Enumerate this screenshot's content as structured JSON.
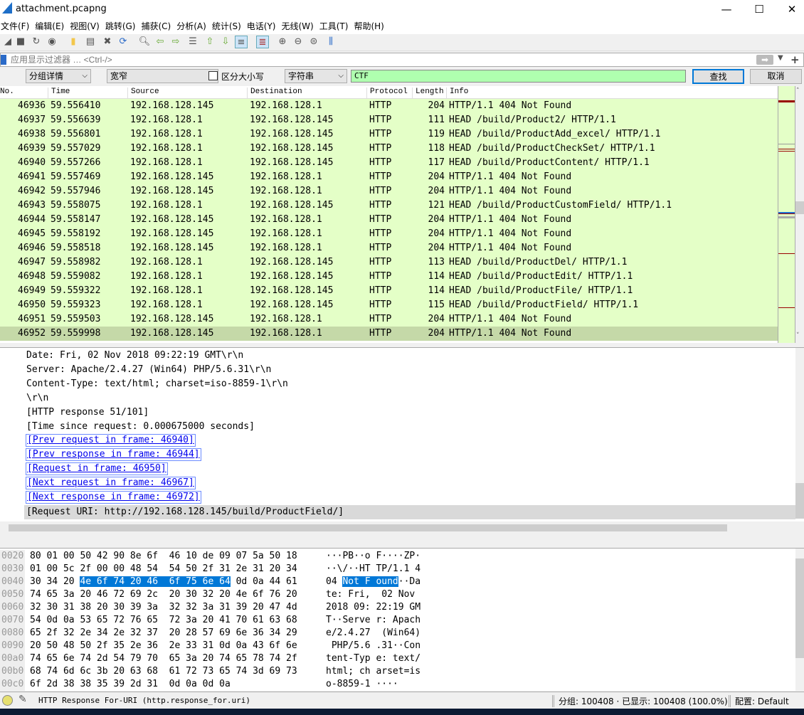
{
  "window": {
    "title": "attachment.pcapng"
  },
  "menu": [
    "文件(F)",
    "编辑(E)",
    "视图(V)",
    "跳转(G)",
    "捕获(C)",
    "分析(A)",
    "统计(S)",
    "电话(Y)",
    "无线(W)",
    "工具(T)",
    "帮助(H)"
  ],
  "filter": {
    "placeholder": "应用显示过滤器 … <Ctrl-/>"
  },
  "find": {
    "search_in": "分组详情",
    "charset": "宽窄",
    "case_label": "区分大小写",
    "case_checked": false,
    "type": "字符串",
    "value": "CTF",
    "find_label": "查找",
    "cancel_label": "取消"
  },
  "packet_list": {
    "columns": [
      "No.",
      "Time",
      "Source",
      "Destination",
      "Protocol",
      "Length",
      "Info"
    ],
    "rows": [
      [
        "46936",
        "59.556410",
        "192.168.128.145",
        "192.168.128.1",
        "HTTP",
        "204",
        "HTTP/1.1 404 Not Found"
      ],
      [
        "46937",
        "59.556639",
        "192.168.128.1",
        "192.168.128.145",
        "HTTP",
        "111",
        "HEAD /build/Product2/ HTTP/1.1"
      ],
      [
        "46938",
        "59.556801",
        "192.168.128.1",
        "192.168.128.145",
        "HTTP",
        "119",
        "HEAD /build/ProductAdd_excel/ HTTP/1.1"
      ],
      [
        "46939",
        "59.557029",
        "192.168.128.1",
        "192.168.128.145",
        "HTTP",
        "118",
        "HEAD /build/ProductCheckSet/ HTTP/1.1"
      ],
      [
        "46940",
        "59.557266",
        "192.168.128.1",
        "192.168.128.145",
        "HTTP",
        "117",
        "HEAD /build/ProductContent/ HTTP/1.1"
      ],
      [
        "46941",
        "59.557469",
        "192.168.128.145",
        "192.168.128.1",
        "HTTP",
        "204",
        "HTTP/1.1 404 Not Found"
      ],
      [
        "46942",
        "59.557946",
        "192.168.128.145",
        "192.168.128.1",
        "HTTP",
        "204",
        "HTTP/1.1 404 Not Found"
      ],
      [
        "46943",
        "59.558075",
        "192.168.128.1",
        "192.168.128.145",
        "HTTP",
        "121",
        "HEAD /build/ProductCustomField/ HTTP/1.1"
      ],
      [
        "46944",
        "59.558147",
        "192.168.128.145",
        "192.168.128.1",
        "HTTP",
        "204",
        "HTTP/1.1 404 Not Found"
      ],
      [
        "46945",
        "59.558192",
        "192.168.128.145",
        "192.168.128.1",
        "HTTP",
        "204",
        "HTTP/1.1 404 Not Found"
      ],
      [
        "46946",
        "59.558518",
        "192.168.128.145",
        "192.168.128.1",
        "HTTP",
        "204",
        "HTTP/1.1 404 Not Found"
      ],
      [
        "46947",
        "59.558982",
        "192.168.128.1",
        "192.168.128.145",
        "HTTP",
        "113",
        "HEAD /build/ProductDel/ HTTP/1.1"
      ],
      [
        "46948",
        "59.559082",
        "192.168.128.1",
        "192.168.128.145",
        "HTTP",
        "114",
        "HEAD /build/ProductEdit/ HTTP/1.1"
      ],
      [
        "46949",
        "59.559322",
        "192.168.128.1",
        "192.168.128.145",
        "HTTP",
        "114",
        "HEAD /build/ProductFile/ HTTP/1.1"
      ],
      [
        "46950",
        "59.559323",
        "192.168.128.1",
        "192.168.128.145",
        "HTTP",
        "115",
        "HEAD /build/ProductField/ HTTP/1.1"
      ],
      [
        "46951",
        "59.559503",
        "192.168.128.145",
        "192.168.128.1",
        "HTTP",
        "204",
        "HTTP/1.1 404 Not Found"
      ],
      [
        "46952",
        "59.559998",
        "192.168.128.145",
        "192.168.128.1",
        "HTTP",
        "204",
        "HTTP/1.1 404 Not Found"
      ]
    ],
    "selected": "46952",
    "row_color": "#e4ffc7"
  },
  "details": [
    {
      "text": "Date: Fri, 02 Nov 2018 09:22:19 GMT\\r\\n",
      "type": "plain"
    },
    {
      "text": "Server: Apache/2.4.27 (Win64) PHP/5.6.31\\r\\n",
      "type": "plain"
    },
    {
      "text": "Content-Type: text/html; charset=iso-8859-1\\r\\n",
      "type": "plain"
    },
    {
      "text": "\\r\\n",
      "type": "plain"
    },
    {
      "text": "[HTTP response 51/101]",
      "type": "plain"
    },
    {
      "text": "[Time since request: 0.000675000 seconds]",
      "type": "plain"
    },
    {
      "text": "[Prev request in frame: 46940]",
      "type": "link"
    },
    {
      "text": "[Prev response in frame: 46944]",
      "type": "link"
    },
    {
      "text": "[Request in frame: 46950]",
      "type": "link"
    },
    {
      "text": "[Next request in frame: 46967]",
      "type": "link"
    },
    {
      "text": "[Next response in frame: 46972]",
      "type": "link"
    },
    {
      "text": "[Request URI: http://192.168.128.145/build/ProductField/]",
      "type": "selected"
    }
  ],
  "hex": [
    {
      "off": "0020",
      "a": "80 01 00 50 42 90 8e 6f",
      "b": "46 10 de 09 07 5a 50 18",
      "asc": "···PB··o F····ZP·"
    },
    {
      "off": "0030",
      "a": "01 00 5c 2f 00 00 48 54",
      "b": "54 50 2f 31 2e 31 20 34",
      "asc": "··\\/··HT TP/1.1 4"
    },
    {
      "off": "0040",
      "a": "30 34 20 ",
      "hl1": "4e 6f 74 20 46",
      "b": "",
      "hl2": "6f 75 6e 64",
      "rest": " 0d 0a 44 61",
      "asc": "04 ",
      "ahl": "Not F ound",
      "arest": "··Da"
    },
    {
      "off": "0050",
      "a": "74 65 3a 20 46 72 69 2c",
      "b": "20 30 32 20 4e 6f 76 20",
      "asc": "te: Fri,  02 Nov "
    },
    {
      "off": "0060",
      "a": "32 30 31 38 20 30 39 3a",
      "b": "32 32 3a 31 39 20 47 4d",
      "asc": "2018 09: 22:19 GM"
    },
    {
      "off": "0070",
      "a": "54 0d 0a 53 65 72 76 65",
      "b": "72 3a 20 41 70 61 63 68",
      "asc": "T··Serve r: Apach"
    },
    {
      "off": "0080",
      "a": "65 2f 32 2e 34 2e 32 37",
      "b": "20 28 57 69 6e 36 34 29",
      "asc": "e/2.4.27  (Win64)"
    },
    {
      "off": "0090",
      "a": "20 50 48 50 2f 35 2e 36",
      "b": "2e 33 31 0d 0a 43 6f 6e",
      "asc": " PHP/5.6 .31··Con"
    },
    {
      "off": "00a0",
      "a": "74 65 6e 74 2d 54 79 70",
      "b": "65 3a 20 74 65 78 74 2f",
      "asc": "tent-Typ e: text/"
    },
    {
      "off": "00b0",
      "a": "68 74 6d 6c 3b 20 63 68",
      "b": "61 72 73 65 74 3d 69 73",
      "asc": "html; ch arset=is"
    },
    {
      "off": "00c0",
      "a": "6f 2d 38 38 35 39 2d 31",
      "b": "0d 0a 0d 0a",
      "asc": "o-8859-1 ····"
    }
  ],
  "status": {
    "field": "HTTP Response For-URI (http.response_for.uri)",
    "packets": "分组: 100408 · 已显示: 100408 (100.0%)",
    "profile": "配置: Default"
  }
}
